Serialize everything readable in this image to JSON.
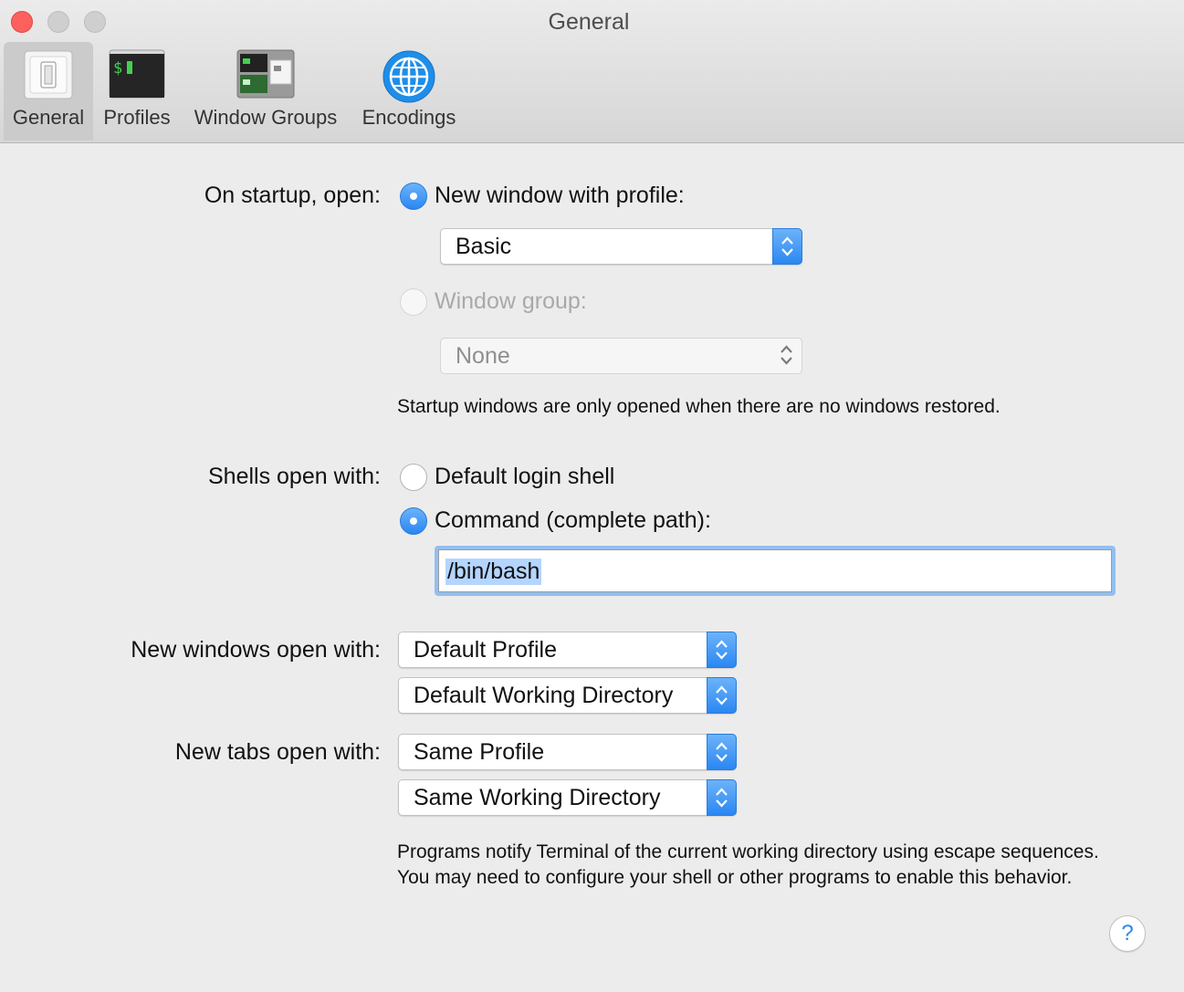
{
  "window": {
    "title": "General"
  },
  "toolbar": {
    "items": [
      {
        "label": "General",
        "icon": "switch-icon",
        "active": true
      },
      {
        "label": "Profiles",
        "icon": "terminal-icon",
        "icon_text": "$"
      },
      {
        "label": "Window Groups",
        "icon": "window-groups-icon"
      },
      {
        "label": "Encodings",
        "icon": "globe-icon"
      }
    ]
  },
  "startup": {
    "label": "On startup, open:",
    "option_new_window": "New window with profile:",
    "profile_value": "Basic",
    "option_window_group": "Window group:",
    "group_value": "None",
    "selected": "new_window",
    "note": "Startup windows are only opened when there are no windows restored."
  },
  "shells": {
    "label": "Shells open with:",
    "option_default": "Default login shell",
    "option_command": "Command (complete path):",
    "selected": "command",
    "command_value": "/bin/bash"
  },
  "new_windows": {
    "label": "New windows open with:",
    "profile_value": "Default Profile",
    "directory_value": "Default Working Directory"
  },
  "new_tabs": {
    "label": "New tabs open with:",
    "profile_value": "Same Profile",
    "directory_value": "Same Working Directory"
  },
  "footer_note": "Programs notify Terminal of the current working directory using escape sequences. You may need to configure your shell or other programs to enable this behavior.",
  "help_label": "?",
  "colors": {
    "accent": "#2a87f2",
    "close": "#fc615d",
    "background": "#ececec"
  }
}
